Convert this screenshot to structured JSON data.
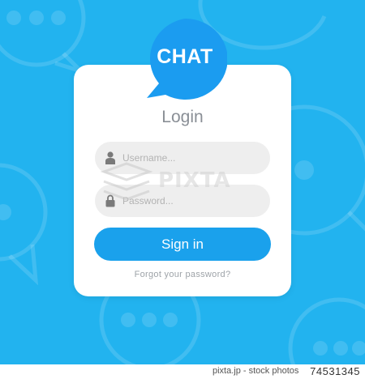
{
  "badge": {
    "text": "CHAT"
  },
  "login": {
    "title": "Login",
    "username_placeholder": "Username...",
    "password_placeholder": "Password...",
    "signin_label": "Sign in",
    "forgot_label": "Forgot your password?"
  },
  "watermark": {
    "text": "PIXTA"
  },
  "footer": {
    "source": "pixta.jp - stock photos",
    "image_id": "74531345"
  },
  "icons": {
    "username": "user-icon",
    "password": "lock-icon",
    "background": "chat-bubble-icon"
  },
  "colors": {
    "background": "#22b3ef",
    "card": "#ffffff",
    "badge": "#1b9cf0",
    "button": "#1aa1ec",
    "field": "#eeeeee",
    "title": "#8a8f96"
  }
}
